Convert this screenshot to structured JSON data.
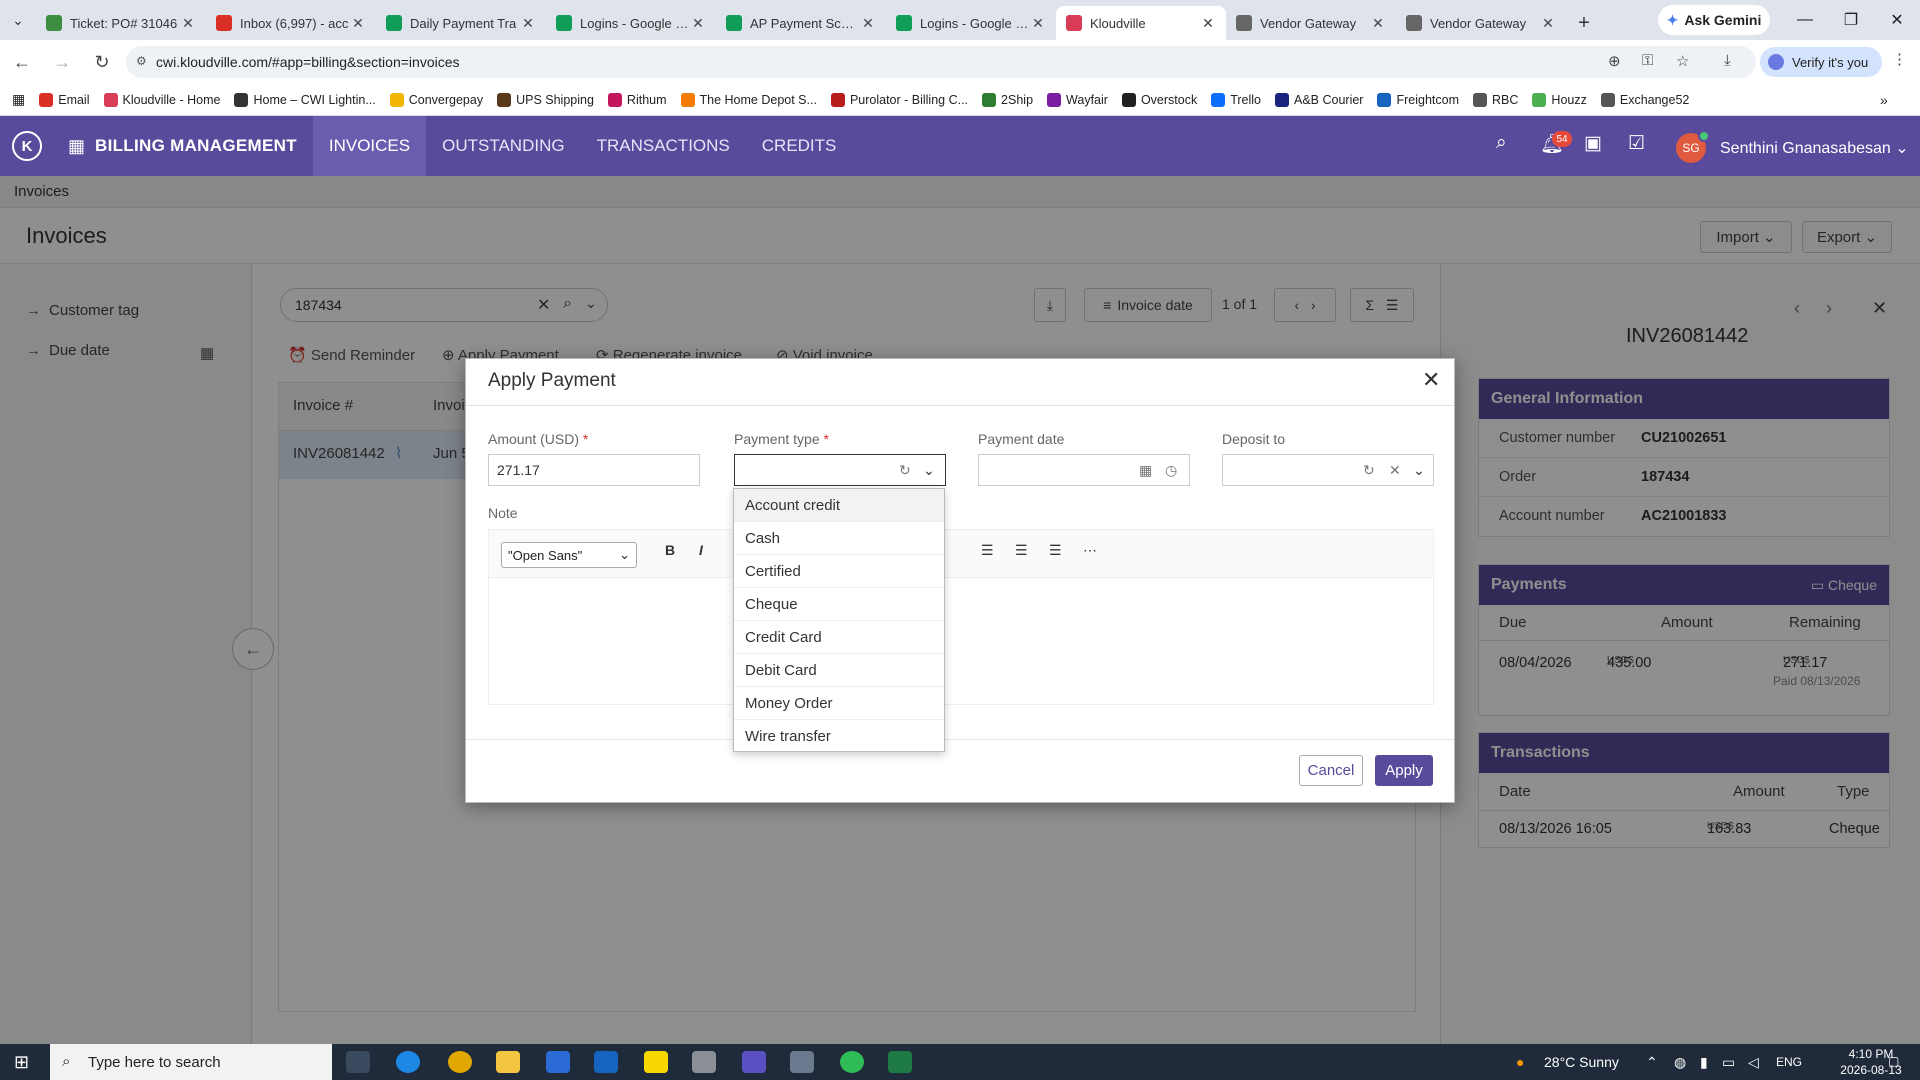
{
  "browser": {
    "tabs": [
      {
        "label": "Ticket: PO# 31046",
        "color": "#3c8d3f"
      },
      {
        "label": "Inbox (6,997) - acc",
        "color": "#d93025"
      },
      {
        "label": "Daily Payment Tra",
        "color": "#0f9d58"
      },
      {
        "label": "Logins - Google Sh",
        "color": "#0f9d58"
      },
      {
        "label": "AP Payment Sched",
        "color": "#0f9d58"
      },
      {
        "label": "Logins - Google Sh",
        "color": "#0f9d58"
      },
      {
        "label": "Kloudville",
        "color": "#d93c56"
      },
      {
        "label": "Vendor Gateway",
        "color": "#666666"
      },
      {
        "label": "Vendor Gateway",
        "color": "#666666"
      }
    ],
    "gemini_label": "Ask Gemini",
    "url": "cwi.kloudville.com/#app=billing&section=invoices",
    "verify_label": "Verify it's you",
    "bookmarks": [
      {
        "label": "Email",
        "color": "#d93025"
      },
      {
        "label": "Kloudville - Home",
        "color": "#d93c56"
      },
      {
        "label": "Home – CWI Lightin...",
        "color": "#333333"
      },
      {
        "label": "Convergepay",
        "color": "#f2b705"
      },
      {
        "label": "UPS Shipping",
        "color": "#5a3a1a"
      },
      {
        "label": "Rithum",
        "color": "#c2185b"
      },
      {
        "label": "The Home Depot S...",
        "color": "#f57c00"
      },
      {
        "label": "Purolator - Billing C...",
        "color": "#b71c1c"
      },
      {
        "label": "2Ship",
        "color": "#2e7d32"
      },
      {
        "label": "Wayfair",
        "color": "#7b1fa2"
      },
      {
        "label": "Overstock",
        "color": "#212121"
      },
      {
        "label": "Trello",
        "color": "#0d6efd"
      },
      {
        "label": "A&B Courier",
        "color": "#1a237e"
      },
      {
        "label": "Freightcom",
        "color": "#1565c0"
      },
      {
        "label": "RBC",
        "color": "#555555"
      },
      {
        "label": "Houzz",
        "color": "#4caf50"
      },
      {
        "label": "Exchange52",
        "color": "#555555"
      }
    ]
  },
  "app": {
    "logo": "K",
    "title": "BILLING MANAGEMENT",
    "tabs": [
      "INVOICES",
      "OUTSTANDING",
      "TRANSACTIONS",
      "CREDITS"
    ],
    "notification_count": "54",
    "avatar_initials": "SG",
    "user_name": "Senthini Gnanasabesan",
    "accent": "#5a4a9c"
  },
  "page": {
    "breadcrumb": "Invoices",
    "title": "Invoices",
    "import_label": "Import",
    "export_label": "Export",
    "filters": [
      "Customer tag",
      "Due date"
    ],
    "search_value": "187434",
    "sort_label": "Invoice date",
    "pagination": "1 of 1",
    "actions": [
      "Send Reminder",
      "Apply Payment",
      "Regenerate invoice",
      "Void invoice"
    ],
    "columns": [
      "Invoice #",
      "Invoi"
    ],
    "row": {
      "invoice": "INV26081442",
      "date": "Jun 5"
    }
  },
  "details": {
    "invoice_title": "INV26081442",
    "general_title": "General Information",
    "general": [
      {
        "k": "Customer number",
        "v": "CU21002651"
      },
      {
        "k": "Order",
        "v": "187434"
      },
      {
        "k": "Account number",
        "v": "AC21001833"
      }
    ],
    "payments_title": "Payments",
    "payments_method": "Cheque",
    "payments_cols": [
      "Due",
      "Amount",
      "Remaining"
    ],
    "payment_row": {
      "due": "08/04/2026",
      "currency": "USD$",
      "amount": "435.00",
      "remaining": "271.17",
      "paid": "Paid 08/13/2026"
    },
    "transactions_title": "Transactions",
    "transactions_cols": [
      "Date",
      "Amount",
      "Type"
    ],
    "transaction_row": {
      "date": "08/13/2026 16:05",
      "currency": "USD$",
      "amount": "163.83",
      "type": "Cheque"
    }
  },
  "modal": {
    "title": "Apply Payment",
    "amount_label": "Amount (USD)",
    "amount_value": "271.17",
    "payment_type_label": "Payment type",
    "payment_date_label": "Payment date",
    "deposit_label": "Deposit to",
    "note_label": "Note",
    "font_value": "\"Open Sans\"",
    "cancel_label": "Cancel",
    "apply_label": "Apply",
    "payment_type_options": [
      "Account credit",
      "Cash",
      "Certified",
      "Cheque",
      "Credit Card",
      "Debit Card",
      "Money Order",
      "Wire transfer"
    ],
    "highlighted_option": "Account credit"
  },
  "taskbar": {
    "search_placeholder": "Type here to search",
    "weather": "28°C  Sunny",
    "language": "ENG",
    "time": "4:10 PM",
    "date": "2026-08-13",
    "notifications": "5"
  }
}
